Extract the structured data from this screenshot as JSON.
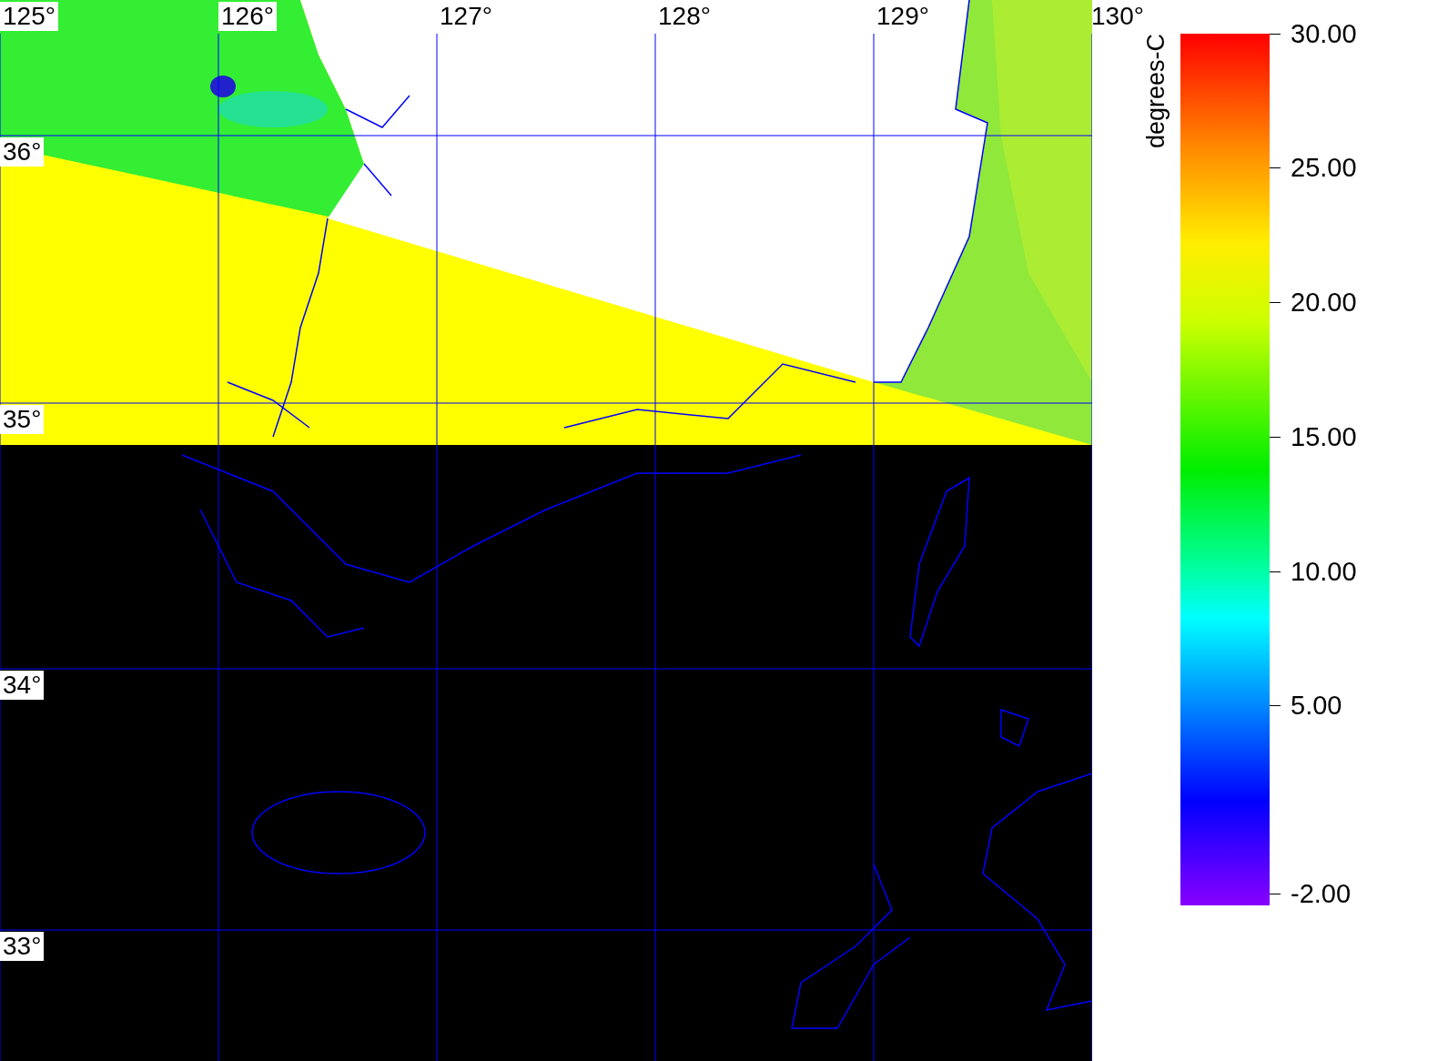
{
  "map": {
    "longitude_labels": [
      "125°",
      "126°",
      "127°",
      "128°",
      "129°",
      "130°"
    ],
    "latitude_labels": [
      "36°",
      "35°",
      "34°",
      "33°"
    ]
  },
  "colorbar": {
    "unit_label": "degrees-C",
    "ticks": [
      "30.00",
      "25.00",
      "20.00",
      "15.00",
      "10.00",
      "5.00",
      "-2.00"
    ]
  }
}
